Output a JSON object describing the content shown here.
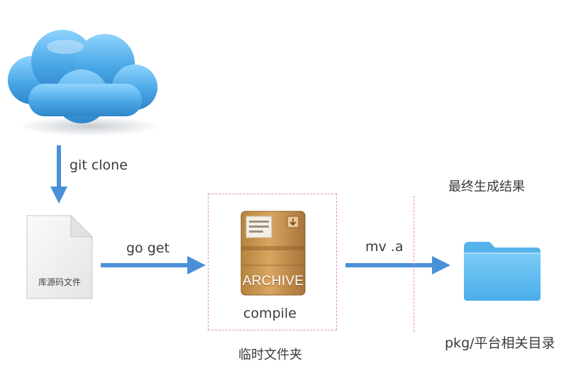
{
  "steps": {
    "git_clone": "git clone",
    "go_get": "go get",
    "mv": "mv .a",
    "compile": "compile"
  },
  "nodes": {
    "source_doc": "库源码文件",
    "archive": "ARCHIVE",
    "temp_folder": "临时文件夹",
    "final_result": "最终生成结果",
    "pkg_dir": "pkg/平台相关目录"
  },
  "colors": {
    "arrow": "#4a90d9",
    "dashed": "#e78bbf",
    "cloud": "#4aa8e6",
    "folder": "#5bb8f0"
  }
}
